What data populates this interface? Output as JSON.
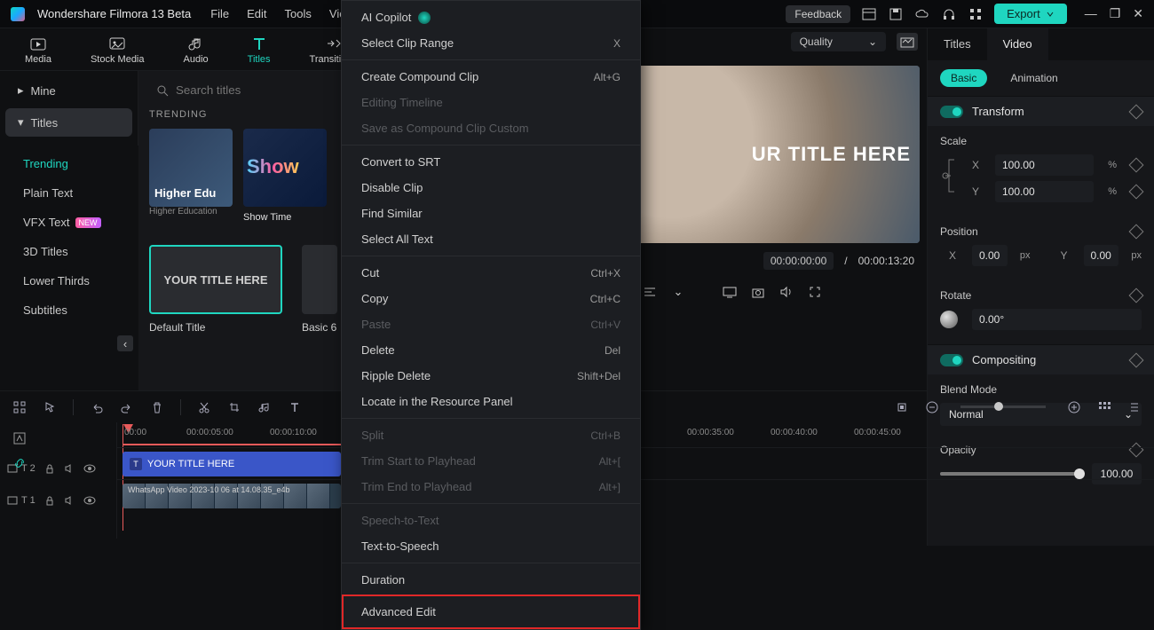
{
  "app": {
    "name": "Wondershare Filmora 13 Beta"
  },
  "menus": [
    "File",
    "Edit",
    "Tools",
    "View"
  ],
  "topright": {
    "feedback": "Feedback",
    "export": "Export"
  },
  "tabs": [
    {
      "id": "media",
      "label": "Media"
    },
    {
      "id": "stock",
      "label": "Stock Media"
    },
    {
      "id": "audio",
      "label": "Audio"
    },
    {
      "id": "titles",
      "label": "Titles"
    },
    {
      "id": "transitions",
      "label": "Transitions"
    }
  ],
  "categories": {
    "mine": "Mine",
    "titles": "Titles"
  },
  "subcategories": [
    {
      "id": "trending",
      "label": "Trending"
    },
    {
      "id": "plain",
      "label": "Plain Text"
    },
    {
      "id": "vfx",
      "label": "VFX Text"
    },
    {
      "id": "3d",
      "label": "3D Titles"
    },
    {
      "id": "lower",
      "label": "Lower Thirds"
    },
    {
      "id": "subtitles",
      "label": "Subtitles"
    }
  ],
  "search": {
    "placeholder": "Search titles"
  },
  "trending_header": "TRENDING",
  "thumbs": {
    "edu": {
      "title": "Higher Edu",
      "sub": "Higher Education"
    },
    "show": {
      "title": "Show",
      "sub": "Show Time"
    }
  },
  "presets": {
    "default": "Default Title",
    "default_text": "YOUR TITLE HERE",
    "basic6": "Basic 6"
  },
  "preview": {
    "quality": "Quality",
    "title_text": "UR TITLE HERE",
    "current": "00:00:00:00",
    "duration": "00:00:13:20"
  },
  "inspector": {
    "tabs": {
      "titles": "Titles",
      "video": "Video"
    },
    "sub": {
      "basic": "Basic",
      "anim": "Animation"
    },
    "transform": "Transform",
    "scale": "Scale",
    "scale_x": "100.00",
    "scale_y": "100.00",
    "position": "Position",
    "pos_x": "0.00",
    "pos_y": "0.00",
    "rotate": "Rotate",
    "rotate_v": "0.00°",
    "compositing": "Compositing",
    "blend": "Blend Mode",
    "blend_v": "Normal",
    "opacity": "Opacity",
    "opacity_v": "100.00"
  },
  "timeline": {
    "times": [
      "00:00",
      "00:00:05:00",
      "00:00:10:00",
      "00:00:35:00",
      "00:00:40:00",
      "00:00:45:00"
    ],
    "title_clip": "YOUR TITLE HERE",
    "video_clip": "WhatsApp Video 2023-10 06 at 14.08.35_e4b",
    "t2": "T 2",
    "t1": "T 1"
  },
  "ctx": {
    "ai": "AI Copilot",
    "range": "Select Clip Range",
    "range_sc": "X",
    "compound": "Create Compound Clip",
    "compound_sc": "Alt+G",
    "edit_tl": "Editing Timeline",
    "save_custom": "Save as Compound Clip Custom",
    "srt": "Convert to SRT",
    "disable": "Disable Clip",
    "similar": "Find Similar",
    "selall": "Select All Text",
    "cut": "Cut",
    "cut_sc": "Ctrl+X",
    "copy": "Copy",
    "copy_sc": "Ctrl+C",
    "paste": "Paste",
    "paste_sc": "Ctrl+V",
    "delete": "Delete",
    "delete_sc": "Del",
    "ripple": "Ripple Delete",
    "ripple_sc": "Shift+Del",
    "locate": "Locate in the Resource Panel",
    "split": "Split",
    "split_sc": "Ctrl+B",
    "trim_s": "Trim Start to Playhead",
    "trim_s_sc": "Alt+[",
    "trim_e": "Trim End to Playhead",
    "trim_e_sc": "Alt+]",
    "stt": "Speech-to-Text",
    "tts": "Text-to-Speech",
    "dur": "Duration",
    "adv": "Advanced Edit"
  },
  "labels": {
    "pct": "%",
    "px": "px",
    "X": "X",
    "Y": "Y"
  }
}
